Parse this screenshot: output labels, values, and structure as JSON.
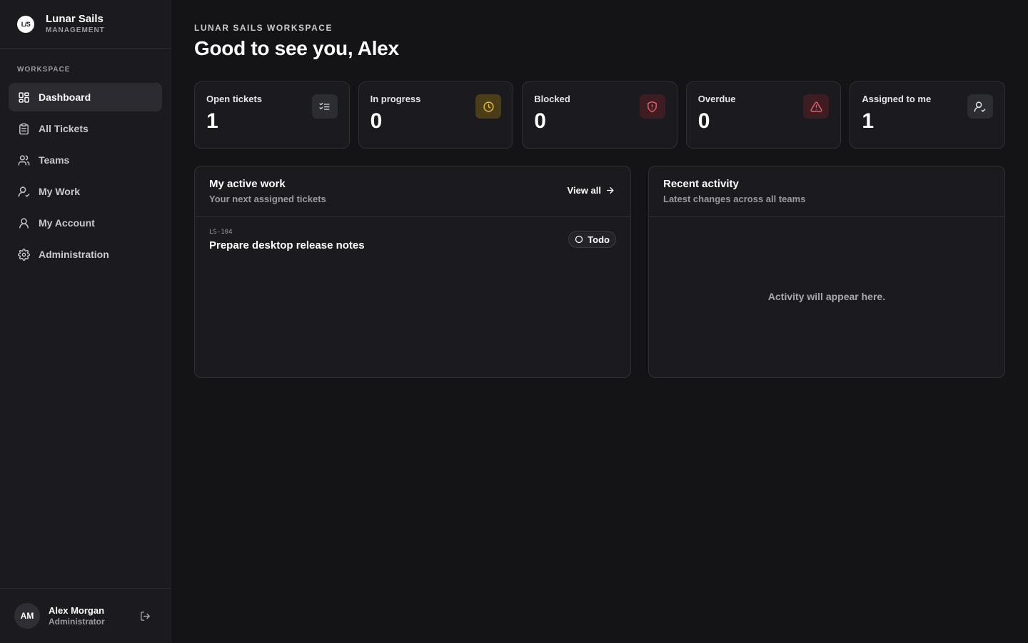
{
  "brand": {
    "logo_text": "L/S",
    "name": "Lunar Sails",
    "subtitle": "MANAGEMENT"
  },
  "sidebar": {
    "section_label": "WORKSPACE",
    "items": [
      {
        "label": "Dashboard",
        "icon": "dashboard-grid-icon",
        "active": true
      },
      {
        "label": "All Tickets",
        "icon": "clipboard-icon",
        "active": false
      },
      {
        "label": "Teams",
        "icon": "users-icon",
        "active": false
      },
      {
        "label": "My Work",
        "icon": "user-check-icon",
        "active": false
      },
      {
        "label": "My Account",
        "icon": "user-icon",
        "active": false
      },
      {
        "label": "Administration",
        "icon": "gear-icon",
        "active": false
      }
    ]
  },
  "user": {
    "initials": "AM",
    "name": "Alex Morgan",
    "role": "Administrator"
  },
  "header": {
    "eyebrow": "LUNAR SAILS WORKSPACE",
    "greeting": "Good to see you, Alex"
  },
  "stats": [
    {
      "label": "Open tickets",
      "value": "1",
      "icon": "list-check-icon",
      "accent": "#9aa0b0"
    },
    {
      "label": "In progress",
      "value": "0",
      "icon": "clock-icon",
      "accent": "#e0b341"
    },
    {
      "label": "Blocked",
      "value": "0",
      "icon": "shield-alert-icon",
      "accent": "#e0535f"
    },
    {
      "label": "Overdue",
      "value": "0",
      "icon": "warning-triangle-icon",
      "accent": "#e0535f"
    },
    {
      "label": "Assigned to me",
      "value": "1",
      "icon": "user-check-icon",
      "accent": "#c8c8cd"
    }
  ],
  "active_work": {
    "title": "My active work",
    "subtitle": "Your next assigned tickets",
    "view_all": "View all",
    "tickets": [
      {
        "id": "LS-104",
        "title": "Prepare desktop release notes",
        "status": "Todo"
      }
    ]
  },
  "activity": {
    "title": "Recent activity",
    "subtitle": "Latest changes across all teams",
    "empty": "Activity will appear here."
  }
}
